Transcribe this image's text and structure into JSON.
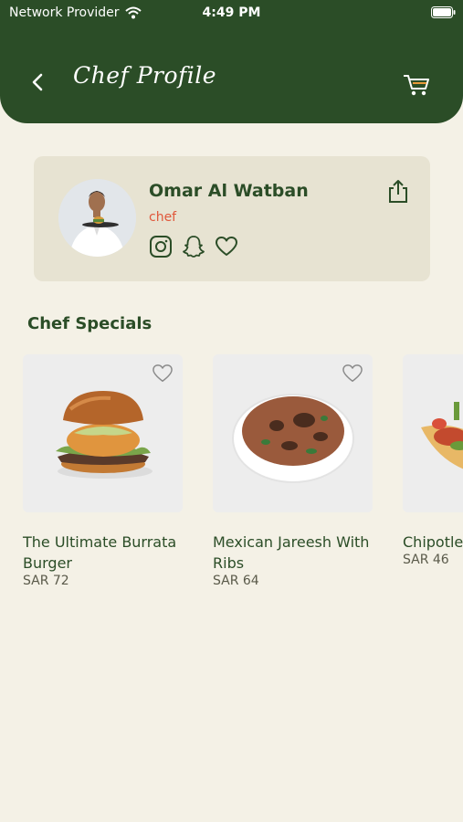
{
  "status_bar": {
    "carrier": "Network Provider",
    "time": "4:49 PM"
  },
  "header": {
    "title": "Chef Profile"
  },
  "chef": {
    "name": "Omar Al Watban",
    "role": "chef"
  },
  "specials": {
    "title": "Chef Specials",
    "items": [
      {
        "name": "The Ultimate Burrata Burger",
        "price": "SAR 72"
      },
      {
        "name": "Mexican Jareesh With Ribs",
        "price": "SAR 64"
      },
      {
        "name": "Chipotle Taco",
        "price": "SAR 46"
      }
    ]
  },
  "colors": {
    "header_green": "#2b4d27",
    "background": "#f4f1e6",
    "card": "#e7e3d2",
    "accent_orange": "#e0573a"
  }
}
